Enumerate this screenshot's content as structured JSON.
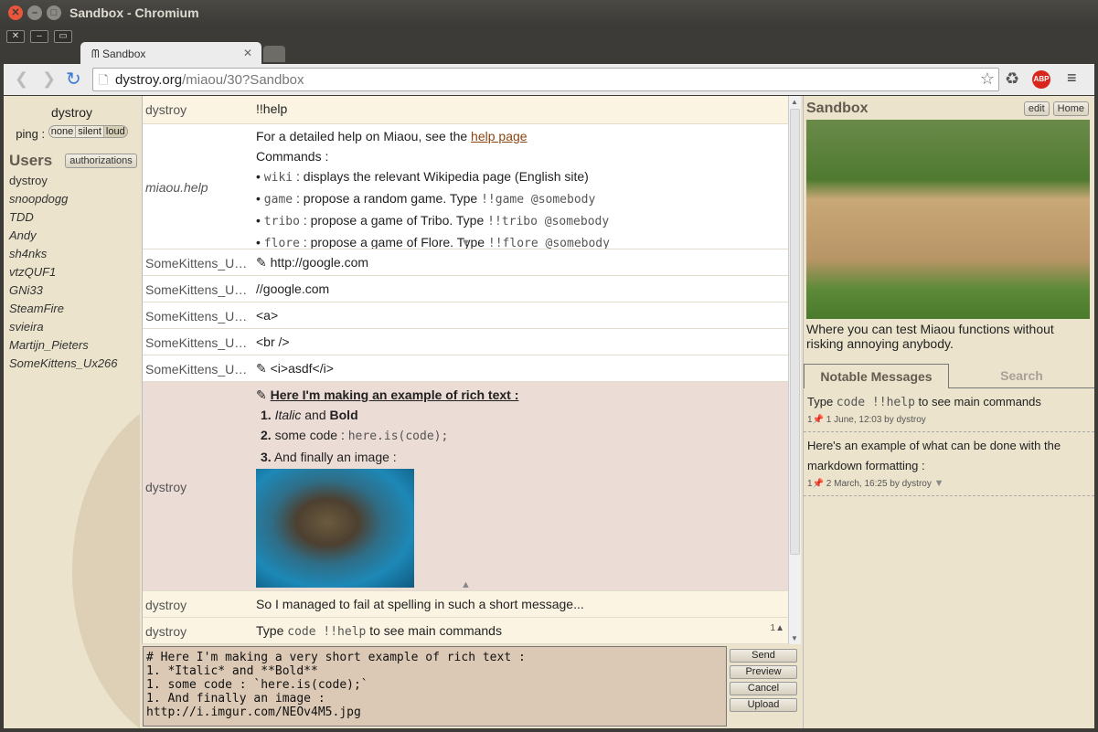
{
  "window": {
    "title": "Sandbox - Chromium"
  },
  "browser": {
    "tab_title": "Sandbox",
    "url_host": "dystroy.org",
    "url_path": "/miaou/30?Sandbox"
  },
  "left": {
    "current_user": "dystroy",
    "ping_label": "ping :",
    "ping_options": [
      "none",
      "silent",
      "loud"
    ],
    "users_heading": "Users",
    "authorizations": "authorizations",
    "users": [
      "dystroy",
      "snoopdogg",
      "TDD",
      "Andy",
      "sh4nks",
      "vtzQUF1",
      "GNi33",
      "SteamFire",
      "svieira",
      "Martijn_Pieters",
      "SomeKittens_Ux266"
    ]
  },
  "chat": {
    "m1": {
      "author": "dystroy",
      "text": "!!help"
    },
    "m2": {
      "author": "miaou.help",
      "intro": "For a detailed help on Miaou, see the ",
      "link": "help page",
      "commands": "Commands :",
      "cmds": [
        {
          "c": "wiki",
          "d": " : displays the relevant Wikipedia page (English site)",
          "e": ""
        },
        {
          "c": "game",
          "d": " : propose a random game. Type ",
          "e": "!!game @somebody"
        },
        {
          "c": "tribo",
          "d": " : propose a game of Tribo. Type ",
          "e": "!!tribo @somebody"
        },
        {
          "c": "flore",
          "d": " : propose a game of Flore. Type ",
          "e": "!!flore @somebody"
        }
      ]
    },
    "m3": {
      "author": "SomeKittens_U…",
      "text": "http://google.com"
    },
    "m4": {
      "author": "SomeKittens_U…",
      "text": "//google.com"
    },
    "m5": {
      "author": "SomeKittens_U…",
      "text": "<a>"
    },
    "m6": {
      "author": "SomeKittens_U…",
      "text": "<br />"
    },
    "m7": {
      "author": "SomeKittens_U…",
      "text": "<i>asdf</i>"
    },
    "m8": {
      "author": "dystroy",
      "heading": "Here I'm making an example of rich text :",
      "i1_italic": "Italic",
      "i1_and": " and ",
      "i1_bold": "Bold",
      "i2": "some code : ",
      "i2_code": "here.is(code);",
      "i3": "And finally an image :"
    },
    "m9": {
      "author": "dystroy",
      "text": "So I managed to fail at spelling in such a short message..."
    },
    "m10": {
      "author": "dystroy",
      "pre": "Type ",
      "code": "code !!help",
      "post": " to see main commands",
      "pins": "1"
    }
  },
  "input": {
    "value": "# Here I'm making a very short example of rich text :\n1. *Italic* and **Bold**\n1. some code : `here.is(code);`\n1. And finally an image :\nhttp://i.imgur.com/NEOv4M5.jpg",
    "send": "Send",
    "preview": "Preview",
    "cancel": "Cancel",
    "upload": "Upload"
  },
  "right": {
    "room": "Sandbox",
    "edit": "edit",
    "home": "Home",
    "description": "Where you can test Miaou functions without risking annoying anybody.",
    "tab_notable": "Notable Messages",
    "tab_search": "Search",
    "notable": [
      {
        "pre": "Type ",
        "code": "code !!help",
        "post": " to see main commands",
        "pins": "1",
        "meta": "1 June, 12:03 by dystroy"
      },
      {
        "text": "Here's an example of what can be done with the markdown formatting :",
        "pins": "1",
        "meta": "2 March, 16:25 by dystroy"
      }
    ]
  }
}
